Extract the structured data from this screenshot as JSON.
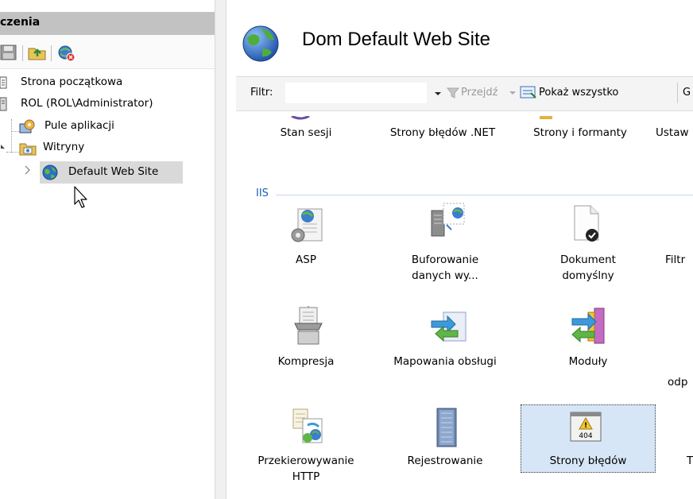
{
  "connections_pane": {
    "header": "czenia",
    "tree": [
      {
        "label": "Strona początkowa",
        "icon": "start-page-icon"
      },
      {
        "label": "ROL (ROL\\Administrator)",
        "icon": "server-icon"
      },
      {
        "label": "Pule aplikacji",
        "icon": "app-pools-icon"
      },
      {
        "label": "Witryny",
        "icon": "sites-folder-icon"
      },
      {
        "label": "Default Web Site",
        "icon": "globe-icon",
        "selected": true
      }
    ]
  },
  "main": {
    "title": "Dom Default Web Site",
    "filter_bar": {
      "label": "Filtr:",
      "value": "",
      "go_label": "Przejdź",
      "show_all_label": "Pokaż wszystko",
      "group_partial": "G"
    },
    "top_row": [
      "Stan sesji",
      "Strony błędów .NET",
      "Strony i formanty",
      "Ustaw"
    ],
    "group_title": "IIS",
    "features": [
      {
        "label_line1": "ASP",
        "label_line2": "",
        "icon": "asp-icon"
      },
      {
        "label_line1": "Buforowanie",
        "label_line2": "danych wy...",
        "icon": "output-caching-icon"
      },
      {
        "label_line1": "Dokument",
        "label_line2": "domyślny",
        "icon": "default-document-icon"
      },
      {
        "label_line1": "Filtr",
        "label_line2": "",
        "icon": "filter-icon"
      },
      {
        "label_line1": "Kompresja",
        "label_line2": "",
        "icon": "compression-icon"
      },
      {
        "label_line1": "Mapowania obsługi",
        "label_line2": "",
        "icon": "handler-mappings-icon"
      },
      {
        "label_line1": "Moduły",
        "label_line2": "",
        "icon": "modules-icon"
      },
      {
        "label_line1": "odp",
        "label_line2": "",
        "icon": "response-icon"
      },
      {
        "label_line1": "Przekierowywanie",
        "label_line2": "HTTP",
        "icon": "http-redirect-icon"
      },
      {
        "label_line1": "Rejestrowanie",
        "label_line2": "",
        "icon": "logging-icon"
      },
      {
        "label_line1": "Strony błędów",
        "label_line2": "",
        "icon": "error-pages-icon",
        "selected": true
      },
      {
        "label_line1": "T",
        "label_line2": "",
        "icon": "truncated-icon"
      }
    ],
    "error_icon_text": "404"
  }
}
